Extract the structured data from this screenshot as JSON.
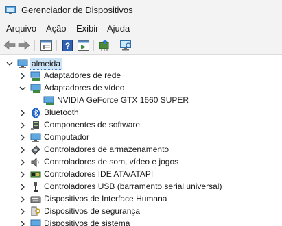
{
  "window": {
    "title": "Gerenciador de Dispositivos"
  },
  "menu": {
    "items": [
      "Arquivo",
      "Ação",
      "Exibir",
      "Ajuda"
    ]
  },
  "toolbar": {
    "buttons": [
      "back-arrow-icon",
      "forward-arrow-icon",
      "properties-icon",
      "help-icon",
      "show-hidden-icon",
      "update-driver-icon",
      "scan-hardware-icon"
    ]
  },
  "tree": {
    "root": "almeida",
    "categories": [
      "Adaptadores de rede",
      "Adaptadores de vídeo",
      "NVIDIA GeForce GTX 1660 SUPER",
      "Bluetooth",
      "Componentes de software",
      "Computador",
      "Controladores de armazenamento",
      "Controladores de som, vídeo e jogos",
      "Controladores IDE ATA/ATAPI",
      "Controladores USB (barramento serial universal)",
      "Dispositivos de Interface Humana",
      "Dispositivos de segurança",
      "Dispositivos de sistema"
    ]
  },
  "colors": {
    "selection": "#cde4f7",
    "selection_border": "#3a78c4",
    "chrome": "#f3f3f3"
  }
}
